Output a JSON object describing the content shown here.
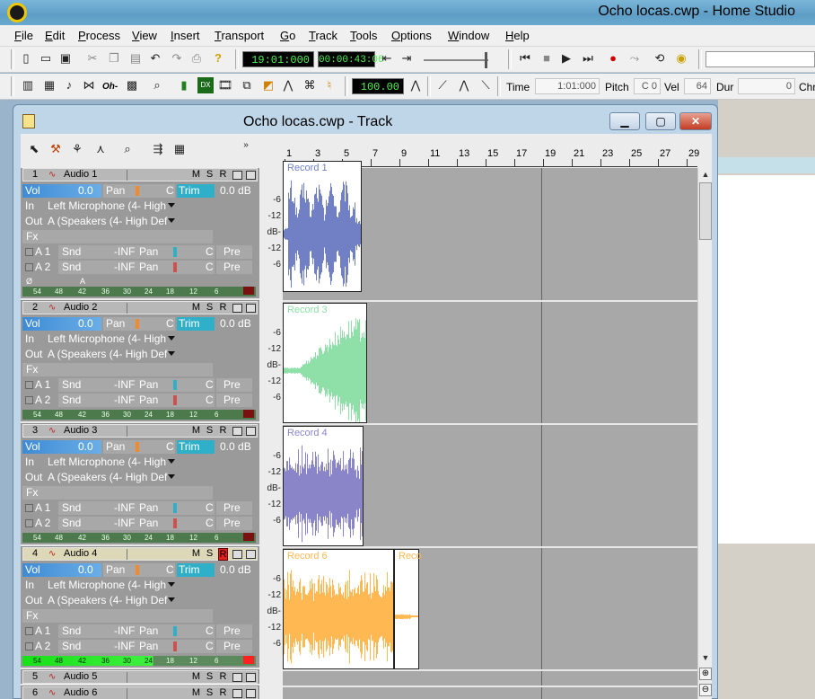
{
  "app": {
    "title": "Ocho locas.cwp - Home Studio"
  },
  "menu": [
    "File",
    "Edit",
    "Process",
    "View",
    "Insert",
    "Transport",
    "Go",
    "Track",
    "Tools",
    "Options",
    "Window",
    "Help"
  ],
  "transport": {
    "time_lcd": "19:01:000",
    "smpte_lcd": "00:00:43:06"
  },
  "toolbar2": {
    "tempo_lcd": "100.00",
    "labels": {
      "time": "Time",
      "pitch": "Pitch",
      "vel": "Vel",
      "dur": "Dur",
      "ch": "Chn"
    },
    "values": {
      "time": "1:01:000",
      "pitch": "C 0",
      "vel": "64",
      "dur": "0"
    }
  },
  "track_window": {
    "title": "Ocho locas.cwp - Track"
  },
  "ruler": [
    "1",
    "3",
    "5",
    "7",
    "9",
    "11",
    "13",
    "15",
    "17",
    "19",
    "21",
    "23",
    "25",
    "27",
    "29"
  ],
  "scale_labels": [
    "-6",
    "-12",
    "dB-",
    "-12",
    "-6"
  ],
  "meter_labels": [
    "54",
    "48",
    "42",
    "36",
    "30",
    "24",
    "18",
    "12",
    "6"
  ],
  "tracks": [
    {
      "num": "1",
      "name": "Audio 1",
      "vol": "0.0",
      "trim": "0.0 dB",
      "input": "Left Microphone (4- High",
      "output": "A (Speakers (4- High Def",
      "clip": "Record 1"
    },
    {
      "num": "2",
      "name": "Audio 2",
      "vol": "0.0",
      "trim": "0.0 dB",
      "input": "Left Microphone (4- High",
      "output": "A (Speakers (4- High Def",
      "clip": "Record 3"
    },
    {
      "num": "3",
      "name": "Audio 3",
      "vol": "0.0",
      "trim": "0.0 dB",
      "input": "Left Microphone (4- High",
      "output": "A (Speakers (4- High Def",
      "clip": "Record 4"
    },
    {
      "num": "4",
      "name": "Audio 4",
      "vol": "0.0",
      "trim": "0.0 dB",
      "input": "Left Microphone (4- High",
      "output": "A (Speakers (4- High Def",
      "clip": "Record 6",
      "clip2": "Reco"
    },
    {
      "num": "5",
      "name": "Audio 5"
    },
    {
      "num": "6",
      "name": "Audio 6"
    }
  ],
  "strip_labels": {
    "vol": "Vol",
    "pan": "Pan",
    "center": "C",
    "trim": "Trim",
    "in": "In",
    "out": "Out",
    "fx": "Fx",
    "send1": "A 1",
    "send2": "A 2",
    "snd": "Snd",
    "inf": "-INF",
    "pre": "Pre",
    "m": "M",
    "s": "S",
    "r": "R",
    "phase": "Ø",
    "auto": "A"
  },
  "colors": {
    "clip1": "#7180c4",
    "clip3": "#8ee0a8",
    "clip4": "#8a84c8",
    "clip6": "#ffb852",
    "vol": "#3f8bd4",
    "trim": "#30b0c8",
    "armed": "#e02020"
  }
}
